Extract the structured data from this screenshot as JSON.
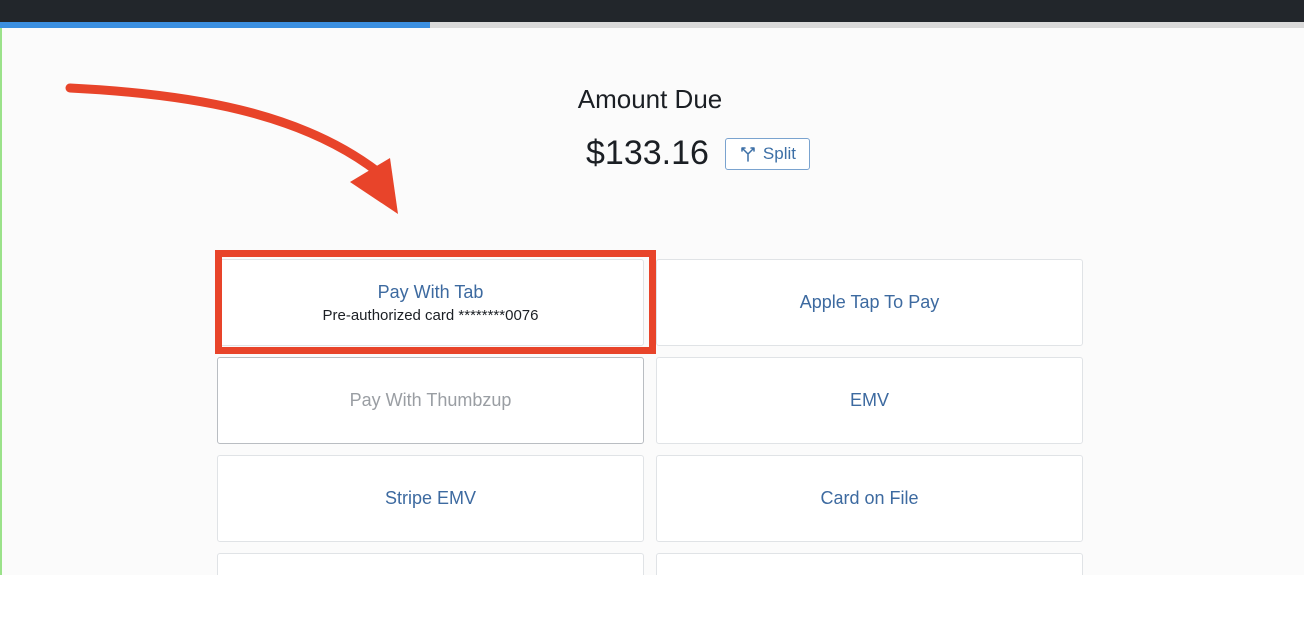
{
  "colors": {
    "accent": "#3b8fe0",
    "button_text": "#3d6aa0",
    "annotation": "#e8442a",
    "topbar": "#22262b"
  },
  "progress": {
    "fraction": 0.33
  },
  "amount": {
    "title": "Amount Due",
    "value": "$133.16",
    "split_label": "Split",
    "split_icon": "split-icon"
  },
  "payment_options": [
    {
      "label": "Pay With Tab",
      "sub": "Pre-authorized card ********0076"
    },
    {
      "label": "Apple Tap To Pay"
    },
    {
      "label": "Pay With Thumbzup"
    },
    {
      "label": "EMV"
    },
    {
      "label": "Stripe EMV"
    },
    {
      "label": "Card on File"
    },
    {
      "label": ""
    },
    {
      "label": ""
    }
  ],
  "annotations": {
    "highlight": "red-highlight-box",
    "arrow": "red-curved-arrow"
  }
}
